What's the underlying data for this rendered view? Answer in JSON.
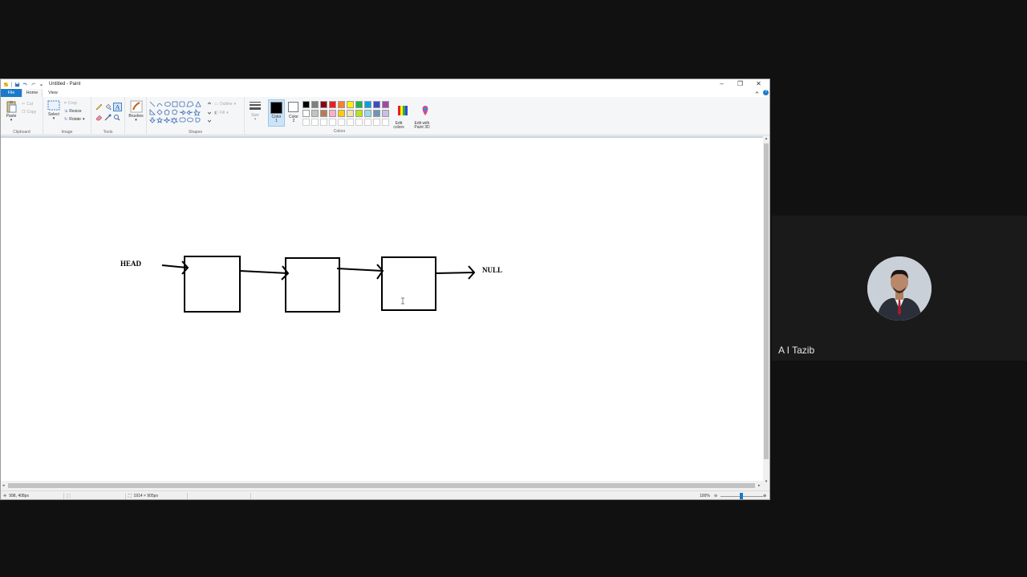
{
  "window": {
    "title": "Untitled - Paint",
    "controls": {
      "minimize": "–",
      "maximize": "❐",
      "close": "✕"
    }
  },
  "tabs": {
    "file": "File",
    "home": "Home",
    "view": "View"
  },
  "help_label": "?",
  "ribbon": {
    "clipboard": {
      "group": "Clipboard",
      "paste": "Paste",
      "cut": "Cut",
      "copy": "Copy"
    },
    "image": {
      "group": "Image",
      "select": "Select",
      "crop": "Crop",
      "resize": "Resize",
      "rotate": "Rotate"
    },
    "tools": {
      "group": "Tools"
    },
    "brushes": {
      "label": "Brushes"
    },
    "shapes": {
      "group": "Shapes",
      "outline": "Outline",
      "fill": "Fill"
    },
    "size": {
      "label": "Size"
    },
    "colors": {
      "group": "Colors",
      "color1": "Color\n1",
      "color2": "Color\n2",
      "edit_colors": "Edit\ncolors",
      "edit_paint3d": "Edit with\nPaint 3D",
      "color1_value": "#000000",
      "color2_value": "#ffffff",
      "palette_row1": [
        "#000000",
        "#7f7f7f",
        "#880015",
        "#ed1c24",
        "#ff7f27",
        "#fff200",
        "#22b14c",
        "#00a2e8",
        "#3f48cc",
        "#a349a4"
      ],
      "palette_row2": [
        "#ffffff",
        "#c3c3c3",
        "#b97a57",
        "#ffaec9",
        "#ffc90e",
        "#efe4b0",
        "#b5e61d",
        "#99d9ea",
        "#7092be",
        "#c8bfe7"
      ],
      "palette_row3": [
        "#ffffff",
        "#ffffff",
        "#ffffff",
        "#ffffff",
        "#ffffff",
        "#ffffff",
        "#ffffff",
        "#ffffff",
        "#ffffff",
        "#ffffff"
      ]
    }
  },
  "canvas_drawing": {
    "head_label": "HEAD",
    "null_label": "NULL",
    "node_count": 3
  },
  "statusbar": {
    "cursor_pos": "998, 408px",
    "canvas_size": "1914 × 905px",
    "zoom": "100%"
  },
  "participant": {
    "name": "A I Tazib"
  }
}
